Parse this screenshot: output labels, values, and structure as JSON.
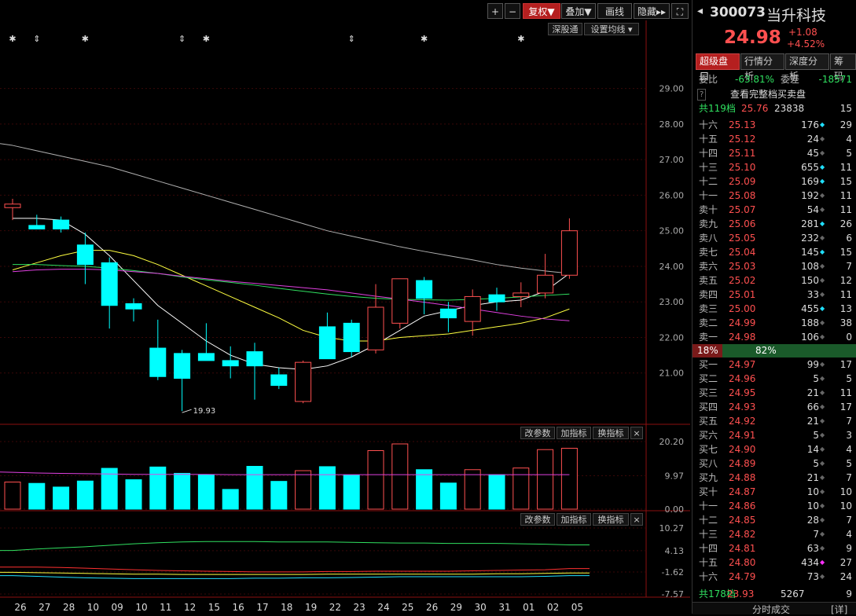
{
  "toolbar": {
    "plus": "+",
    "minus": "−",
    "fuquan": "复权▼",
    "overlay": "叠加▼",
    "draw": "画线",
    "hide": "隐藏▸▸",
    "expand": "⛶"
  },
  "main_chart": {
    "sz_button": "深股通",
    "ma_button": "设置均线 ▾",
    "low_label": "19.93"
  },
  "sub1": {
    "btn1": "改参数",
    "btn2": "加指标",
    "btn3": "换指标",
    "close": "×"
  },
  "sub2": {
    "btn1": "改参数",
    "btn2": "加指标",
    "btn3": "换指标",
    "close": "×"
  },
  "chart_data": [
    {
      "type": "candlestick",
      "categories": [
        "26",
        "27",
        "28",
        "10",
        "09",
        "10",
        "11",
        "12",
        "15",
        "16",
        "17",
        "18",
        "19",
        "22",
        "23",
        "24",
        "25",
        "26",
        "29",
        "30",
        "31",
        "01",
        "02",
        "05"
      ],
      "ohlc": [
        [
          25.65,
          25.9,
          25.3,
          25.75
        ],
        [
          25.15,
          25.45,
          25.05,
          25.05
        ],
        [
          25.3,
          25.4,
          24.95,
          25.05
        ],
        [
          24.6,
          24.95,
          23.5,
          24.05
        ],
        [
          24.1,
          24.25,
          22.25,
          22.9
        ],
        [
          22.95,
          23.1,
          22.45,
          22.8
        ],
        [
          21.7,
          22.5,
          20.8,
          20.9
        ],
        [
          21.55,
          21.65,
          19.93,
          20.85
        ],
        [
          21.55,
          22.4,
          21.35,
          21.35
        ],
        [
          21.35,
          21.75,
          20.85,
          21.2
        ],
        [
          21.6,
          21.85,
          20.25,
          21.2
        ],
        [
          20.95,
          21.15,
          20.55,
          20.65
        ],
        [
          20.2,
          21.35,
          20.15,
          21.3
        ],
        [
          22.3,
          22.7,
          21.6,
          21.4
        ],
        [
          22.4,
          22.5,
          21.45,
          21.6
        ],
        [
          21.65,
          23.5,
          21.55,
          22.85
        ],
        [
          22.4,
          23.65,
          22.25,
          23.65
        ],
        [
          23.6,
          23.7,
          22.65,
          23.1
        ],
        [
          22.8,
          23.0,
          22.15,
          22.55
        ],
        [
          22.45,
          23.35,
          22.05,
          23.15
        ],
        [
          23.2,
          23.4,
          22.75,
          23.0
        ],
        [
          23.15,
          23.55,
          22.85,
          23.25
        ],
        [
          23.25,
          24.35,
          23.1,
          23.75
        ],
        [
          23.75,
          25.35,
          23.65,
          25.0
        ]
      ],
      "ylim": [
        20.0,
        29.5
      ],
      "yticks": [
        "29.00",
        "28.00",
        "27.00",
        "26.00",
        "25.00",
        "24.00",
        "23.00",
        "22.00",
        "21.00"
      ],
      "series": [
        {
          "values": [
            25.35,
            25.35,
            25.3,
            24.9,
            24.3,
            23.6,
            22.9,
            22.4,
            21.9,
            21.5,
            21.25,
            21.15,
            21.1,
            21.2,
            21.45,
            21.8,
            22.2,
            22.6,
            22.75,
            22.9,
            23.0,
            23.05,
            23.3,
            23.8
          ]
        },
        {
          "values": [
            23.9,
            24.1,
            24.3,
            24.45,
            24.45,
            24.3,
            24.05,
            23.75,
            23.45,
            23.15,
            22.85,
            22.55,
            22.2,
            22.0,
            21.9,
            21.9,
            22.0,
            22.05,
            22.1,
            22.2,
            22.3,
            22.4,
            22.55,
            22.8
          ]
        },
        {
          "values": [
            24.05,
            24.05,
            24.02,
            24.0,
            23.95,
            23.88,
            23.8,
            23.7,
            23.62,
            23.55,
            23.47,
            23.38,
            23.3,
            23.22,
            23.15,
            23.1,
            23.07,
            23.06,
            23.05,
            23.07,
            23.1,
            23.14,
            23.18,
            23.22
          ]
        },
        {
          "values": [
            23.85,
            23.9,
            23.92,
            23.92,
            23.9,
            23.85,
            23.8,
            23.72,
            23.65,
            23.58,
            23.52,
            23.46,
            23.4,
            23.34,
            23.25,
            23.16,
            23.08,
            22.99,
            22.9,
            22.8,
            22.7,
            22.6,
            22.52,
            22.47
          ]
        },
        {
          "values": [
            27.4,
            27.25,
            27.1,
            26.95,
            26.8,
            26.6,
            26.4,
            26.2,
            26.0,
            25.8,
            25.6,
            25.4,
            25.2,
            25.0,
            24.85,
            24.7,
            24.55,
            24.42,
            24.3,
            24.18,
            24.05,
            23.95,
            23.87,
            23.8
          ]
        }
      ],
      "markers": [
        "✱",
        "⇕",
        "",
        "✱",
        "",
        "",
        "",
        "⇕",
        "✱",
        "",
        "",
        "",
        "",
        "",
        "⇕",
        "",
        "",
        "✱",
        "",
        "",
        "",
        "✱",
        "",
        ""
      ]
    },
    {
      "type": "bar",
      "ylim": [
        0,
        20.2
      ],
      "yticks": [
        "20.20",
        "9.97",
        "0.00"
      ],
      "values": [
        8.1,
        7.7,
        6.6,
        8.4,
        12.2,
        8.8,
        12.6,
        10.7,
        10.3,
        5.9,
        12.8,
        8.3,
        11.5,
        12.7,
        10.2,
        17.5,
        19.5,
        11.8,
        7.8,
        11.8,
        10.3,
        12.3,
        17.8,
        18.2
      ],
      "ma": [
        11.0,
        10.8,
        10.7,
        10.6,
        10.5,
        10.4,
        10.4,
        10.4,
        10.4,
        10.3,
        10.3,
        10.3,
        10.3,
        10.3,
        10.3,
        10.3,
        10.3,
        10.3,
        10.3,
        10.3,
        10.3,
        10.3,
        10.3,
        10.3
      ]
    },
    {
      "type": "line",
      "ylim": [
        -7.57,
        10.27
      ],
      "yticks": [
        "10.27",
        "4.13",
        "-1.62",
        "-7.57"
      ],
      "series": [
        {
          "values": [
            4.2,
            4.6,
            4.9,
            5.2,
            5.6,
            6.0,
            6.3,
            6.5,
            6.6,
            6.6,
            6.6,
            6.5,
            6.5,
            6.5,
            6.4,
            6.3,
            6.2,
            6.2,
            6.1,
            6.1,
            6.1,
            6.0,
            5.9,
            5.7
          ]
        },
        {
          "values": [
            -0.3,
            -0.3,
            -0.4,
            -0.6,
            -0.8,
            -1.0,
            -1.2,
            -1.3,
            -1.4,
            -1.5,
            -1.6,
            -1.6,
            -1.6,
            -1.5,
            -1.5,
            -1.4,
            -1.4,
            -1.4,
            -1.4,
            -1.3,
            -1.2,
            -1.1,
            -1.0,
            -0.7
          ]
        },
        {
          "values": [
            -1.7,
            -1.8,
            -1.9,
            -2.0,
            -2.1,
            -2.2,
            -2.2,
            -2.3,
            -2.3,
            -2.3,
            -2.3,
            -2.3,
            -2.3,
            -2.2,
            -2.2,
            -2.2,
            -2.2,
            -2.2,
            -2.2,
            -2.2,
            -2.1,
            -2.1,
            -2.0,
            -1.9
          ]
        },
        {
          "values": [
            -2.6,
            -2.8,
            -3.0,
            -3.2,
            -3.3,
            -3.4,
            -3.4,
            -3.4,
            -3.4,
            -3.4,
            -3.3,
            -3.3,
            -3.2,
            -3.2,
            -3.1,
            -3.0,
            -2.9,
            -2.9,
            -2.9,
            -2.9,
            -2.9,
            -2.9,
            -2.8,
            -2.6
          ]
        }
      ]
    }
  ],
  "stock": {
    "code": "300073",
    "name": "当升科技",
    "price": "24.98",
    "change": "+1.08",
    "pct": "+4.52%"
  },
  "tabs": [
    "超级盘口",
    "行情分析",
    "深度分析",
    "筹码"
  ],
  "weibi": {
    "label": "委比",
    "value": "-63.81%",
    "label2": "委差",
    "value2": "-18571"
  },
  "book_header": {
    "q": "?",
    "title": "查看完整档买卖盘"
  },
  "sell_total": {
    "label": "共119档",
    "price": "25.76",
    "vol": "23838",
    "cnt": "15"
  },
  "sells": [
    {
      "label": "十六",
      "price": "25.13",
      "vol": "176",
      "dot": "cyan",
      "cnt": "29"
    },
    {
      "label": "十五",
      "price": "25.12",
      "vol": "24",
      "dot": "gray",
      "cnt": "4"
    },
    {
      "label": "十四",
      "price": "25.11",
      "vol": "45",
      "dot": "gray",
      "cnt": "5"
    },
    {
      "label": "十三",
      "price": "25.10",
      "vol": "655",
      "dot": "cyan",
      "cnt": "11"
    },
    {
      "label": "十二",
      "price": "25.09",
      "vol": "169",
      "dot": "cyan",
      "cnt": "15"
    },
    {
      "label": "十一",
      "price": "25.08",
      "vol": "192",
      "dot": "gray",
      "cnt": "11"
    },
    {
      "label": "卖十",
      "price": "25.07",
      "vol": "54",
      "dot": "gray",
      "cnt": "11"
    },
    {
      "label": "卖九",
      "price": "25.06",
      "vol": "281",
      "dot": "cyan",
      "cnt": "26"
    },
    {
      "label": "卖八",
      "price": "25.05",
      "vol": "232",
      "dot": "gray",
      "cnt": "6"
    },
    {
      "label": "卖七",
      "price": "25.04",
      "vol": "145",
      "dot": "cyan",
      "cnt": "15"
    },
    {
      "label": "卖六",
      "price": "25.03",
      "vol": "108",
      "dot": "gray",
      "cnt": "7"
    },
    {
      "label": "卖五",
      "price": "25.02",
      "vol": "150",
      "dot": "gray",
      "cnt": "12"
    },
    {
      "label": "卖四",
      "price": "25.01",
      "vol": "33",
      "dot": "gray",
      "cnt": "11"
    },
    {
      "label": "卖三",
      "price": "25.00",
      "vol": "455",
      "dot": "cyan",
      "cnt": "13"
    },
    {
      "label": "卖二",
      "price": "24.99",
      "vol": "188",
      "dot": "gray",
      "cnt": "38"
    },
    {
      "label": "卖一",
      "price": "24.98",
      "vol": "106",
      "dot": "gray",
      "cnt": "0"
    }
  ],
  "ratio": {
    "sell": "18%",
    "buy": "82%",
    "sell_fraction": 0.18
  },
  "buys": [
    {
      "label": "买一",
      "price": "24.97",
      "vol": "99",
      "dot": "gray",
      "cnt": "17"
    },
    {
      "label": "买二",
      "price": "24.96",
      "vol": "5",
      "dot": "gray",
      "cnt": "5"
    },
    {
      "label": "买三",
      "price": "24.95",
      "vol": "21",
      "dot": "gray",
      "cnt": "11"
    },
    {
      "label": "买四",
      "price": "24.93",
      "vol": "66",
      "dot": "gray",
      "cnt": "17"
    },
    {
      "label": "买五",
      "price": "24.92",
      "vol": "21",
      "dot": "gray",
      "cnt": "7"
    },
    {
      "label": "买六",
      "price": "24.91",
      "vol": "5",
      "dot": "gray",
      "cnt": "3"
    },
    {
      "label": "买七",
      "price": "24.90",
      "vol": "14",
      "dot": "gray",
      "cnt": "4"
    },
    {
      "label": "买八",
      "price": "24.89",
      "vol": "5",
      "dot": "gray",
      "cnt": "5"
    },
    {
      "label": "买九",
      "price": "24.88",
      "vol": "21",
      "dot": "gray",
      "cnt": "7"
    },
    {
      "label": "买十",
      "price": "24.87",
      "vol": "10",
      "dot": "gray",
      "cnt": "10"
    },
    {
      "label": "十一",
      "price": "24.86",
      "vol": "10",
      "dot": "gray",
      "cnt": "10"
    },
    {
      "label": "十二",
      "price": "24.85",
      "vol": "28",
      "dot": "gray",
      "cnt": "7"
    },
    {
      "label": "十三",
      "price": "24.82",
      "vol": "7",
      "dot": "gray",
      "cnt": "4"
    },
    {
      "label": "十四",
      "price": "24.81",
      "vol": "63",
      "dot": "gray",
      "cnt": "9"
    },
    {
      "label": "十五",
      "price": "24.80",
      "vol": "434",
      "dot": "magenta",
      "cnt": "27"
    },
    {
      "label": "十六",
      "price": "24.79",
      "vol": "73",
      "dot": "gray",
      "cnt": "24"
    }
  ],
  "buy_total": {
    "label": "共178档",
    "price": "23.93",
    "vol": "5267",
    "cnt": "9"
  },
  "bottom": {
    "tab1": "分时成交",
    "tab2": "[详]"
  },
  "colors": {
    "up": "#ff5050",
    "down": "#00ffff",
    "ma5": "#ffffff",
    "ma10": "#ffff40",
    "ma20": "#30e060",
    "ma30": "#e040e0",
    "ma60": "#b0b0b0"
  }
}
